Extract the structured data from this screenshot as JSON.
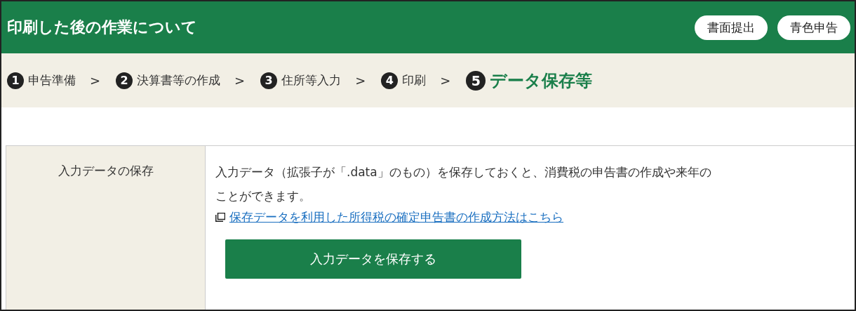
{
  "header": {
    "title": "印刷した後の作業について",
    "buttons": [
      "書面提出",
      "青色申告"
    ]
  },
  "steps": [
    {
      "number": "1",
      "label": "申告準備",
      "selected": false,
      "after": ">"
    },
    {
      "number": "2",
      "label": "決算書等の作成",
      "selected": false,
      "after": ">"
    },
    {
      "number": "3",
      "label": "住所等入力",
      "selected": false,
      "after": ">"
    },
    {
      "number": "4",
      "label": "印刷",
      "selected": false,
      "after": ">"
    },
    {
      "number": "5",
      "label": "データ保存等",
      "selected": true
    }
  ],
  "table": {
    "rows": [
      {
        "heading": "入力データの保存",
        "text_lines": [
          "入力データ（拡張子が「.data」のもの）を保存しておくと、消費税の申告書の作成や来年の",
          "ことができます。"
        ],
        "link": "保存データを利用した所得税の確定申告書の作成方法はこちら",
        "button": "入力データを保存する"
      }
    ]
  }
}
